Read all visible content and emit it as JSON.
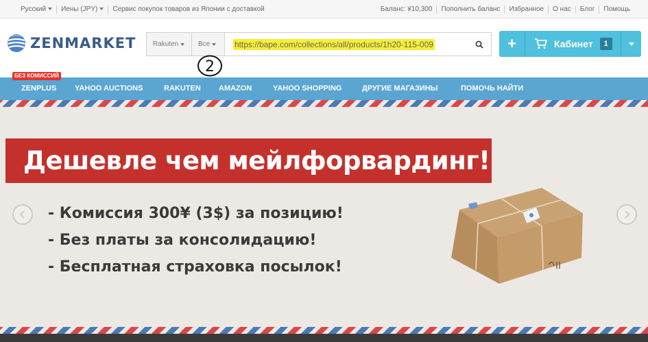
{
  "topbar": {
    "language": "Русский",
    "currency": "Иены (JPY)",
    "tagline": "Сервис покупок товаров из Японии с доставкой",
    "balance": "Баланс: ¥10,300",
    "links": [
      "Пополнить баланс",
      "Избранное",
      "О нас",
      "Блог",
      "Помощь"
    ]
  },
  "logo": {
    "text": "ZENMARKET"
  },
  "search": {
    "shop_select": "Rakuten",
    "category_select": "Все",
    "value": "https://bape.com/collections/all/products/1h20-115-009"
  },
  "annotation": {
    "text": "2"
  },
  "cabinet": {
    "plus": "+",
    "label": "Кабинет",
    "count": "1"
  },
  "nav": {
    "badge": "БЕЗ КОМИССИЙ",
    "items": [
      "ZENPLUS",
      "YAHOO AUCTIONS",
      "RAKUTEN",
      "AMAZON",
      "YAHOO SHOPPING",
      "ДРУГИЕ МАГАЗИНЫ",
      "ПОМОЧЬ НАЙТИ"
    ]
  },
  "banner": {
    "headline": "Дешевле чем мейлфорвардинг!",
    "bullets": [
      "- Комиссия 300¥ (3$) за позицию!",
      "- Без платы за консолидацию!",
      "- Бесплатная страховка посылок!"
    ]
  },
  "colors": {
    "nav_bg": "#5aa5d2",
    "cabinet_bg": "#4fc0de",
    "headline_bar": "#c4312c",
    "url_highlight": "#f6ef35",
    "brand": "#3c5b8a"
  },
  "icons": [
    "globe-logo-icon",
    "search-icon",
    "cart-icon",
    "chevron-left-icon",
    "chevron-right-icon",
    "parcel-image"
  ]
}
